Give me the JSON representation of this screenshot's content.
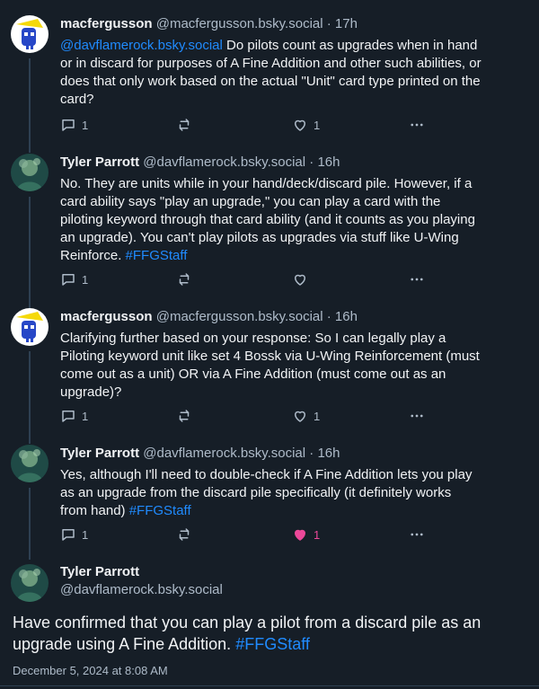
{
  "posts": [
    {
      "author": "macfergusson",
      "handle": "@macfergusson.bsky.social",
      "time": "17h",
      "mention": "@davflamerock.bsky.social",
      "text_lines": [
        "  Do pilots count as upgrades when in hand",
        "or in discard for purposes of A Fine Addition and other such abilities, or",
        "does that only work based on the actual \"Unit\" card type printed on the",
        "card?"
      ],
      "replies": "1",
      "likes": "1",
      "liked": false
    },
    {
      "author": "Tyler Parrott",
      "handle": "@davflamerock.bsky.social",
      "time": "16h",
      "text_lines": [
        "No. They are units while in your hand/deck/discard pile. However, if a",
        "card ability says \"play an upgrade,\" you can play a card with the",
        "piloting keyword through that card ability (and it counts as you playing",
        "an upgrade). You can't play pilots as upgrades via stuff like U-Wing",
        "Reinforce. "
      ],
      "hashtag": "#FFGStaff",
      "replies": "1",
      "likes": "",
      "liked": false
    },
    {
      "author": "macfergusson",
      "handle": "@macfergusson.bsky.social",
      "time": "16h",
      "text_lines": [
        "Clarifying further based on your response: So I can legally play a",
        "Piloting keyword unit like set 4 Bossk via U-Wing Reinforcement (must",
        "come out as a unit) OR via A Fine Addition (must come out as an",
        "upgrade)?"
      ],
      "replies": "1",
      "likes": "1",
      "liked": false
    },
    {
      "author": "Tyler Parrott",
      "handle": "@davflamerock.bsky.social",
      "time": "16h",
      "text_lines": [
        "Yes, although I'll need to double-check if A Fine Addition lets you play",
        "as an upgrade from the discard pile specifically (it definitely works",
        "from hand) "
      ],
      "hashtag": "#FFGStaff",
      "replies": "1",
      "likes": "1",
      "liked": true
    }
  ],
  "main_post": {
    "author": "Tyler Parrott",
    "handle": "@davflamerock.bsky.social",
    "text_lines": [
      "Have confirmed that you can play a pilot from a discard pile as an",
      "upgrade using A Fine Addition. "
    ],
    "hashtag": "#FFGStaff",
    "date": "December 5, 2024 at 8:08 AM"
  },
  "separator": " · ",
  "colors": {
    "background": "#161e27",
    "link": "#208bfe",
    "muted": "#aebbc9",
    "like": "#ec4899"
  }
}
